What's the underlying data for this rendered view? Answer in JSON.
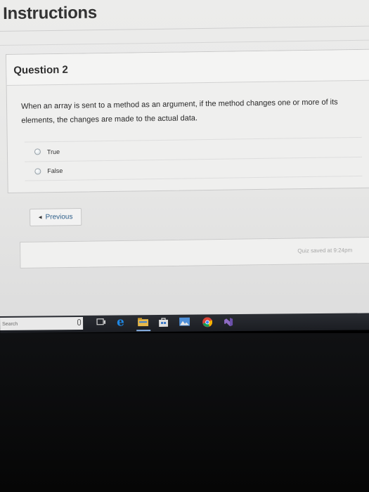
{
  "page": {
    "title": "Instructions"
  },
  "question": {
    "number_label": "Question 2",
    "text": "When an array is sent to a method as an argument, if the method changes one or more of its elements, the changes are made to the actual data.",
    "answers": [
      {
        "label": "True",
        "selected": false
      },
      {
        "label": "False",
        "selected": false
      }
    ]
  },
  "navigation": {
    "previous_label": "Previous",
    "previous_icon": "left-triangle-icon"
  },
  "status": {
    "saved_text": "Quiz saved at 9:24pm"
  },
  "taskbar": {
    "search_placeholder": "Search",
    "icons": [
      "mic-icon",
      "task-view-icon",
      "edge-icon",
      "file-explorer-icon",
      "store-icon",
      "photos-icon",
      "chrome-icon",
      "visual-studio-icon"
    ]
  },
  "colors": {
    "page_background": "#e9e9e8",
    "accent_link": "#2e5f8a",
    "taskbar": "#1f2126",
    "edge_blue": "#1e88e5"
  }
}
